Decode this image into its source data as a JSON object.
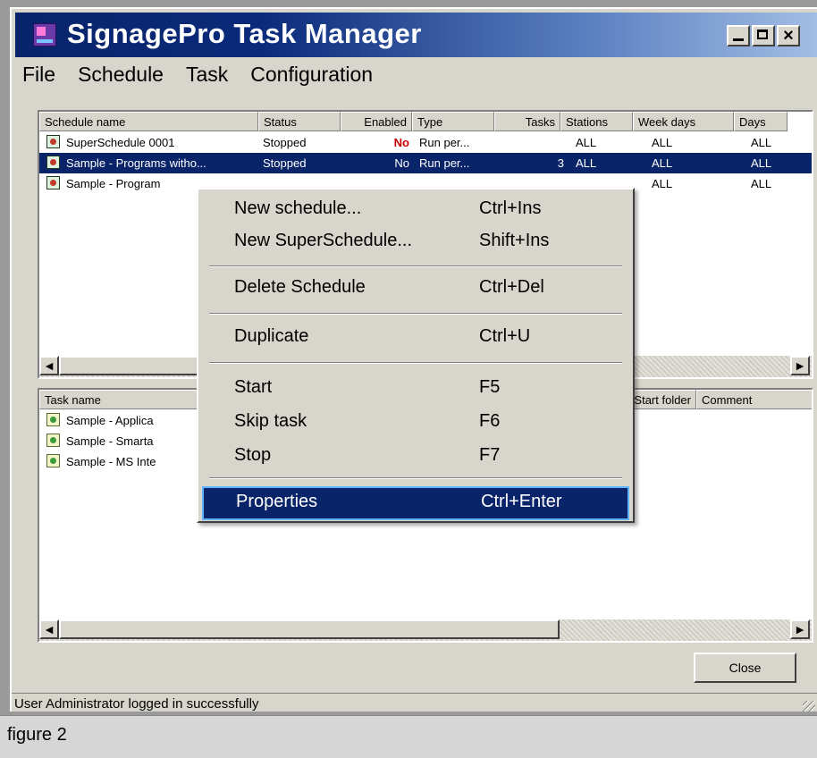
{
  "window": {
    "title": "SignagePro Task Manager",
    "controls": {
      "minimize": "_",
      "maximize": "□",
      "close": "×"
    }
  },
  "menubar": {
    "items": [
      "File",
      "Schedule",
      "Task",
      "Configuration"
    ]
  },
  "schedules": {
    "columns": [
      "Schedule name",
      "Status",
      "Enabled",
      "Type",
      "Tasks",
      "Stations",
      "Week days",
      "Days"
    ],
    "rows": [
      {
        "name": "SuperSchedule 0001",
        "status": "Stopped",
        "enabled": "No",
        "type": "Run per...",
        "tasks": "",
        "stations": "ALL",
        "weekdays": "ALL",
        "days": "ALL"
      },
      {
        "name": "Sample - Programs witho...",
        "status": "Stopped",
        "enabled": "No",
        "type": "Run per...",
        "tasks": "3",
        "stations": "ALL",
        "weekdays": "ALL",
        "days": "ALL"
      },
      {
        "name": "Sample - Program",
        "status": "",
        "enabled": "",
        "type": "",
        "tasks": "",
        "stations": "",
        "weekdays": "ALL",
        "days": "ALL"
      }
    ],
    "enabled_color": "#cc0000"
  },
  "tasks": {
    "columns": [
      "Task name",
      "Start folder",
      "Comment"
    ],
    "rows": [
      {
        "name": "Sample - Applica"
      },
      {
        "name": "Sample - Smarta"
      },
      {
        "name": "Sample - MS Inte"
      }
    ]
  },
  "context_menu": {
    "items": [
      {
        "label": "New schedule...",
        "shortcut": "Ctrl+Ins"
      },
      {
        "label": "New SuperSchedule...",
        "shortcut": "Shift+Ins"
      },
      {
        "label": "Delete Schedule",
        "shortcut": "Ctrl+Del"
      },
      {
        "label": "Duplicate",
        "shortcut": "Ctrl+U"
      },
      {
        "label": "Start",
        "shortcut": "F5"
      },
      {
        "label": "Skip task",
        "shortcut": "F6"
      },
      {
        "label": "Stop",
        "shortcut": "F7"
      },
      {
        "label": "Properties",
        "shortcut": "Ctrl+Enter"
      }
    ],
    "highlighted": "Properties",
    "highlight_color": "#0a246a"
  },
  "scroll": {
    "left": "◄",
    "right": "►"
  },
  "buttons": {
    "close": "Close"
  },
  "statusbar": {
    "text": "User Administrator logged in successfully"
  },
  "caption": "figure 2"
}
